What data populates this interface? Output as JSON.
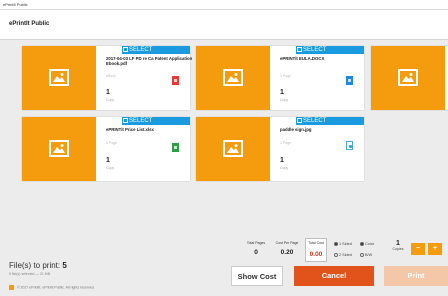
{
  "window": {
    "title": "ePrintIt Public"
  },
  "header": {
    "title": "ePrintIt Public"
  },
  "cards": [
    {
      "select_label": "SELECT",
      "filename": "2017-04-03 LF PD re Ca Patent Application Ebook.pdf",
      "meta": "eBook",
      "copies": "1",
      "copy_label": "Copy",
      "file_icon": "pdf-icon"
    },
    {
      "select_label": "SELECT",
      "filename": "ePRINTit EULA.DOCX",
      "meta": "1 Page",
      "copies": "1",
      "copy_label": "Copy",
      "file_icon": "docx-icon"
    },
    {
      "select_label": "SELECT",
      "filename": "ePRINTit Price List.xlsx",
      "meta": "1 Page",
      "copies": "1",
      "copy_label": "Copy",
      "file_icon": "xlsx-icon"
    },
    {
      "select_label": "SELECT",
      "filename": "paddle sign.jpg",
      "meta": "1 Page",
      "copies": "1",
      "copy_label": "Copy",
      "file_icon": "image-file-icon"
    }
  ],
  "summary": {
    "files_label": "File(s) to print:",
    "files_count": "5",
    "subtitle": "5 file(s) selected — 21 MB",
    "footer": "© 2017 ePrintIt. ePrintIt Public. All rights reserved."
  },
  "stats": {
    "total_pages_label": "Total Pages",
    "total_pages": "0",
    "cost_per_page_label": "Cost Per Page",
    "cost_per_page": "0.20",
    "total_cost_label": "Total Cost",
    "total_cost": "0.00"
  },
  "options": {
    "one_sided": "1 Sided",
    "two_sided": "2 Sided",
    "color": "Color",
    "bw": "B/W"
  },
  "copies": {
    "value": "1",
    "label": "Copies",
    "minus": "−",
    "plus": "+"
  },
  "buttons": {
    "show_cost": "Show Cost",
    "cancel": "Cancel",
    "print": "Print"
  },
  "colors": {
    "accent": "#f59c0e",
    "select": "#1a9be0",
    "cancel": "#e2531b",
    "print_disabled": "#f3c7a8"
  }
}
